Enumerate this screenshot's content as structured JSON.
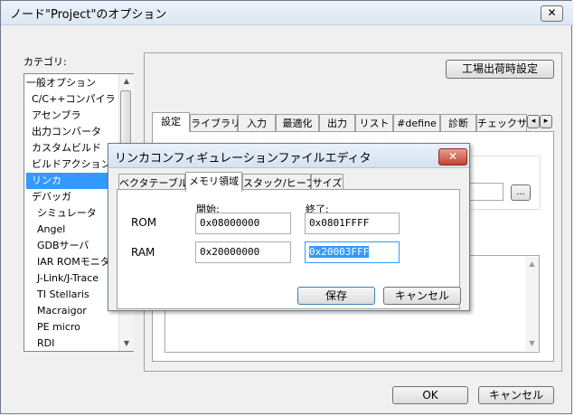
{
  "window": {
    "title": "ノード\"Project\"のオプション",
    "close": "✕"
  },
  "category": {
    "label": "カテゴリ:",
    "items": [
      "一般オプション",
      "C/C++コンパイラ",
      "アセンブラ",
      "出力コンバータ",
      "カスタムビルド",
      "ビルドアクション",
      "リンカ",
      "デバッガ",
      "シミュレータ",
      "Angel",
      "GDBサーバ",
      "IAR ROMモニタ",
      "J-Link/J-Trace",
      "TI Stellaris",
      "Macraigor",
      "PE micro",
      "RDI"
    ],
    "selected": "リンカ"
  },
  "factory_settings": "工場出荷時設定",
  "tabs": [
    "設定",
    "ライブラリ",
    "入力",
    "最適化",
    "出力",
    "リスト",
    "#define",
    "診断",
    "チェックサム"
  ],
  "tab_scroll": {
    "left": "◂",
    "right": "▸"
  },
  "ellipsis": "...",
  "dialog": {
    "title": "リンカコンフィギュレーションファイルエディタ",
    "close": "✕",
    "tabs": [
      "ベクタテーブル",
      "メモリ領域",
      "スタック/ヒープ",
      "サイズ"
    ],
    "active_tab": "メモリ領域",
    "col_start": "開始:",
    "col_end": "終了:",
    "rows": [
      {
        "name": "ROM",
        "start": "0x08000000",
        "end": "0x0801FFFF"
      },
      {
        "name": "RAM",
        "start": "0x20000000",
        "end": "0x20003FFF"
      }
    ],
    "save": "保存",
    "cancel": "キャンセル"
  },
  "buttons": {
    "ok": "OK",
    "cancel": "キャンセル"
  }
}
